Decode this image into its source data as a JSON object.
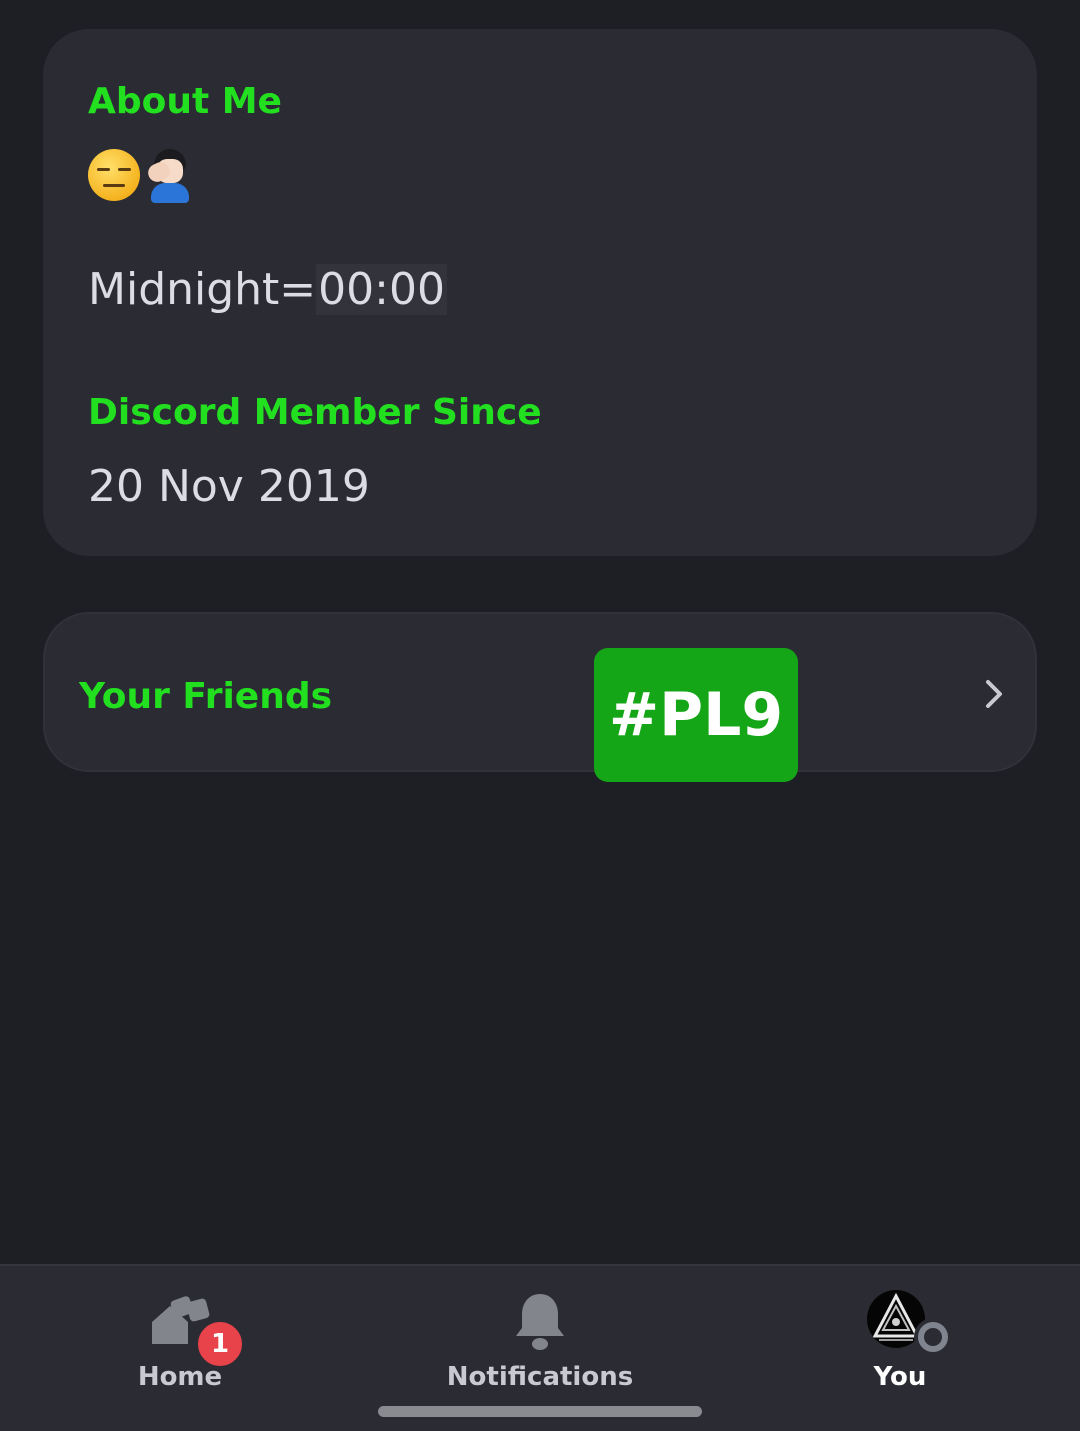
{
  "about_card": {
    "about_heading": "About Me",
    "emojis": [
      "expressionless-face-emoji",
      "person-facepalming-emoji"
    ],
    "bio_text_prefix": "Midnight=",
    "bio_text_code": "00:00",
    "member_since_heading": "Discord Member Since",
    "member_since_date": "20 Nov 2019"
  },
  "friends_card": {
    "heading": "Your Friends",
    "chevron_icon": "chevron-right-icon"
  },
  "tag_badge": {
    "text": "#PL9",
    "color": "#15a617"
  },
  "bottom_nav": {
    "items": [
      {
        "label": "Home",
        "icon": "home-servers-icon",
        "badge_count": "1"
      },
      {
        "label": "Notifications",
        "icon": "bell-icon"
      },
      {
        "label": "You",
        "icon": "avatar",
        "status": "offline"
      }
    ]
  },
  "colors": {
    "heading_green": "#22e01f",
    "background": "#1e1f24",
    "card": "#2b2c33",
    "badge_red": "#e8424a"
  }
}
